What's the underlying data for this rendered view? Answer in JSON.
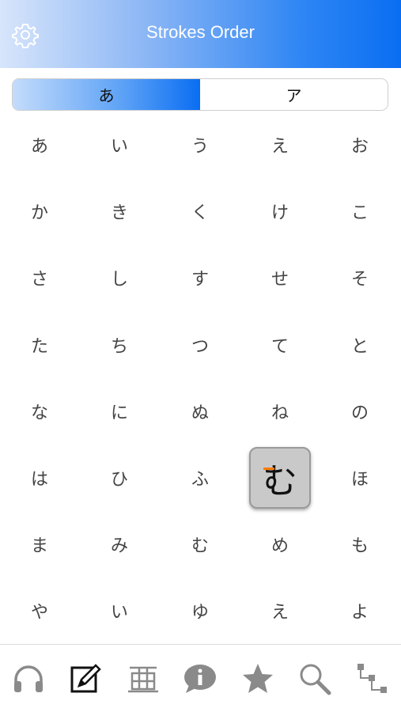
{
  "header": {
    "title": "Strokes Order",
    "settings_icon": "gear-icon"
  },
  "segment": {
    "hiragana_label": "あ",
    "katakana_label": "ア",
    "selected": "hiragana"
  },
  "grid": {
    "rows": [
      [
        "あ",
        "い",
        "う",
        "え",
        "お"
      ],
      [
        "か",
        "き",
        "く",
        "け",
        "こ"
      ],
      [
        "さ",
        "し",
        "す",
        "せ",
        "そ"
      ],
      [
        "た",
        "ち",
        "つ",
        "て",
        "と"
      ],
      [
        "な",
        "に",
        "ぬ",
        "ね",
        "の"
      ],
      [
        "は",
        "ひ",
        "ふ",
        "む",
        "ほ"
      ],
      [
        "ま",
        "み",
        "む",
        "め",
        "も"
      ],
      [
        "や",
        "い",
        "ゆ",
        "え",
        "よ"
      ]
    ],
    "selected": {
      "row": 5,
      "col": 3
    }
  },
  "tabbar": {
    "icons": [
      "headphones-icon",
      "edit-icon",
      "grid-icon",
      "info-icon",
      "star-icon",
      "search-icon",
      "hierarchy-icon"
    ]
  },
  "colors": {
    "accent": "#0a6ef2",
    "icon": "#8a8a8a",
    "active_icon": "#111111",
    "highlight_stroke": "#ff7a00"
  }
}
